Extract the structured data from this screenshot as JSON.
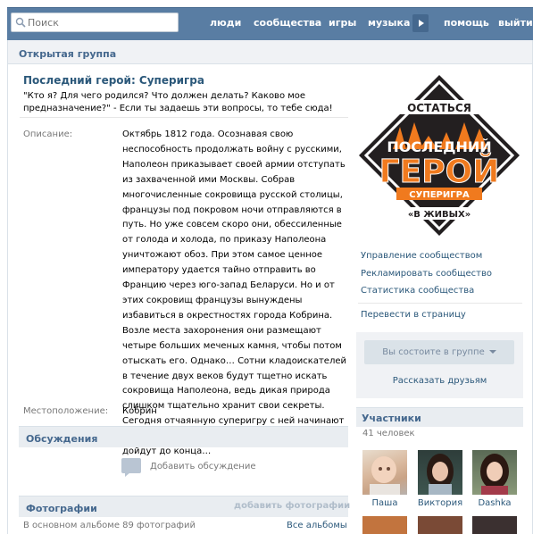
{
  "topbar": {
    "search_placeholder": "Поиск",
    "nav": [
      "люди",
      "сообщества",
      "игры",
      "музыка",
      "помощь",
      "выйти"
    ]
  },
  "group": {
    "type_label": "Открытая группа",
    "title": "Последний герой: Суперигра",
    "status": "\"Кто я? Для чего родился? Что должен делать? Каково мое предназначение?\" - Если ты задаешь эти вопросы, то тебе сюда!",
    "description_label": "Описание:",
    "description": "Октябрь 1812 года. Осознавая свою неспособность продолжать войну с русскими, Наполеон приказывает своей армии отступать из захваченной ими Москвы. Собрав многочисленные сокровища русской столицы, французы под покровом ночи отправляются в путь. Но уже совсем скоро они, обессиленные от голода и холода, по приказу Наполеона уничтожают обоз. При этом самое ценное императору удается тайно отправить во Францию через юго-запад Беларуси. Но и от этих сокровищ французы вынуждены избавиться в окрестностях города Кобрина. Возле места захоронения они размещают четыре больших меченых камня, чтобы потом отыскать его. Однако… Сотни кладоискателей в течение двух веков будут тщетно искать сокровища Наполеона, ведь дикая природа слишком тщательно хранит свои секреты. Сегодня отчаянную суперигру с ней начинают белорусские подростки. И только достойные дойдут до конца…",
    "location_label": "Местоположение:",
    "location": "Кобрин"
  },
  "discussions": {
    "header": "Обсуждения",
    "add": "Добавить обсуждение"
  },
  "photos": {
    "header": "Фотографии",
    "add": "добавить фотографии",
    "count_text": "В основном альбоме 89 фотографий",
    "all_albums": "Все альбомы"
  },
  "logo": {
    "line1": "ОСТАТЬСЯ",
    "line2": "ПОСЛЕДНИЙ",
    "line3": "ГЕРОЙ",
    "line4": "СУПЕРИГРА",
    "line5": "«В ЖИВЫХ»"
  },
  "admin": {
    "manage": "Управление сообществом",
    "advertise": "Рекламировать сообщество",
    "stats": "Статистика сообщества",
    "to_page": "Перевести в страницу"
  },
  "membership": {
    "button": "Вы состоите в группе",
    "tell_friends": "Рассказать друзьям"
  },
  "members": {
    "header": "Участники",
    "count": "41 человек",
    "list": [
      {
        "name": "Паша"
      },
      {
        "name": "Виктория"
      },
      {
        "name": "Dashka"
      }
    ]
  },
  "colors": {
    "brand_blue": "#597da3",
    "link": "#2b587a",
    "logo_orange": "#f07a1e"
  }
}
